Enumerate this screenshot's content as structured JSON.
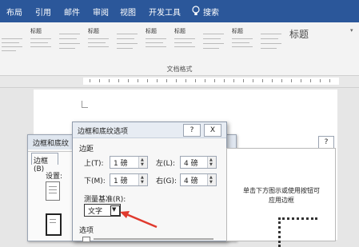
{
  "ribbon": {
    "tabs": [
      "布局",
      "引用",
      "邮件",
      "审阅",
      "视图",
      "开发工具"
    ],
    "search_label": "搜索",
    "style_gallery": [
      "标题",
      "标题",
      "标题",
      "标题",
      "标题"
    ],
    "big_style": "标题",
    "group_label": "文档格式"
  },
  "back_dialog": {
    "title": "边框和底纹",
    "tab_border": "边框(B)",
    "setting_label": "设置:"
  },
  "front_dialog": {
    "title": "边框和底纹选项",
    "help_btn": "?",
    "close_btn": "X",
    "margin_group": "边距",
    "top_label": "上(T):",
    "top_value": "1 磅",
    "left_label": "左(L):",
    "left_value": "4 磅",
    "bottom_label": "下(M):",
    "bottom_value": "1 磅",
    "right_label": "右(G):",
    "right_value": "4 磅",
    "measure_label": "测量基准(R):",
    "measure_value": "文字",
    "options_label": "选项"
  },
  "preview": {
    "help_btn": "?",
    "hint_line1": "单击下方图示或使用按钮可",
    "hint_line2": "应用边框"
  },
  "colors": {
    "ribbon": "#2b579a",
    "arrow": "#e03a2e"
  }
}
